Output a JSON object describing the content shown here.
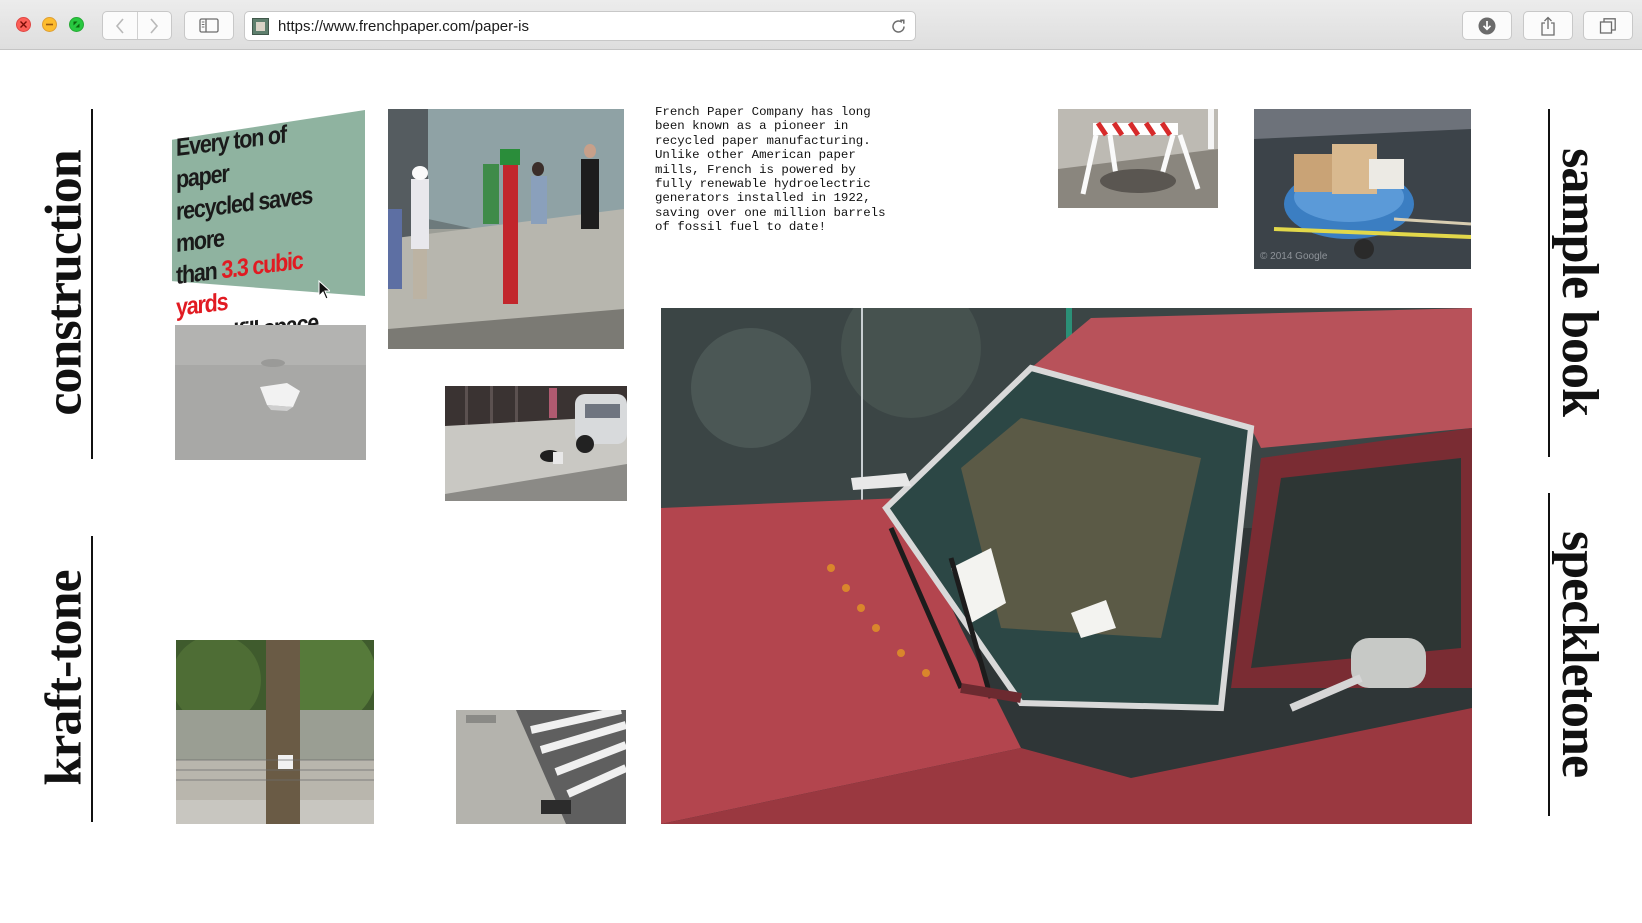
{
  "browser": {
    "url": "https://www.frenchpaper.com/paper-is"
  },
  "labels": {
    "left_top": "construction",
    "left_bottom": "kraft-tone",
    "right_top": "sample book",
    "right_bottom": "speckletone"
  },
  "intro": {
    "text": "French Paper Company has long been known as a pioneer in recycled paper manufacturing. Unlike other American paper mills, French is powered by fully renewable hydroelectric generators installed in 1922, saving over one million barrels of fossil fuel to date!"
  },
  "sign": {
    "line1": "Every ton of paper",
    "line2": "recycled saves more",
    "line3_pre": "than ",
    "line3_hl": "3.3 cubic yards",
    "line4": "of landfill space"
  },
  "photos": {
    "wheelbarrow_watermark": "© 2014 Google"
  },
  "colors": {
    "accent_red": "#e11b22",
    "truck_red": "#b5404a",
    "sign_green": "#8fb3a0"
  }
}
